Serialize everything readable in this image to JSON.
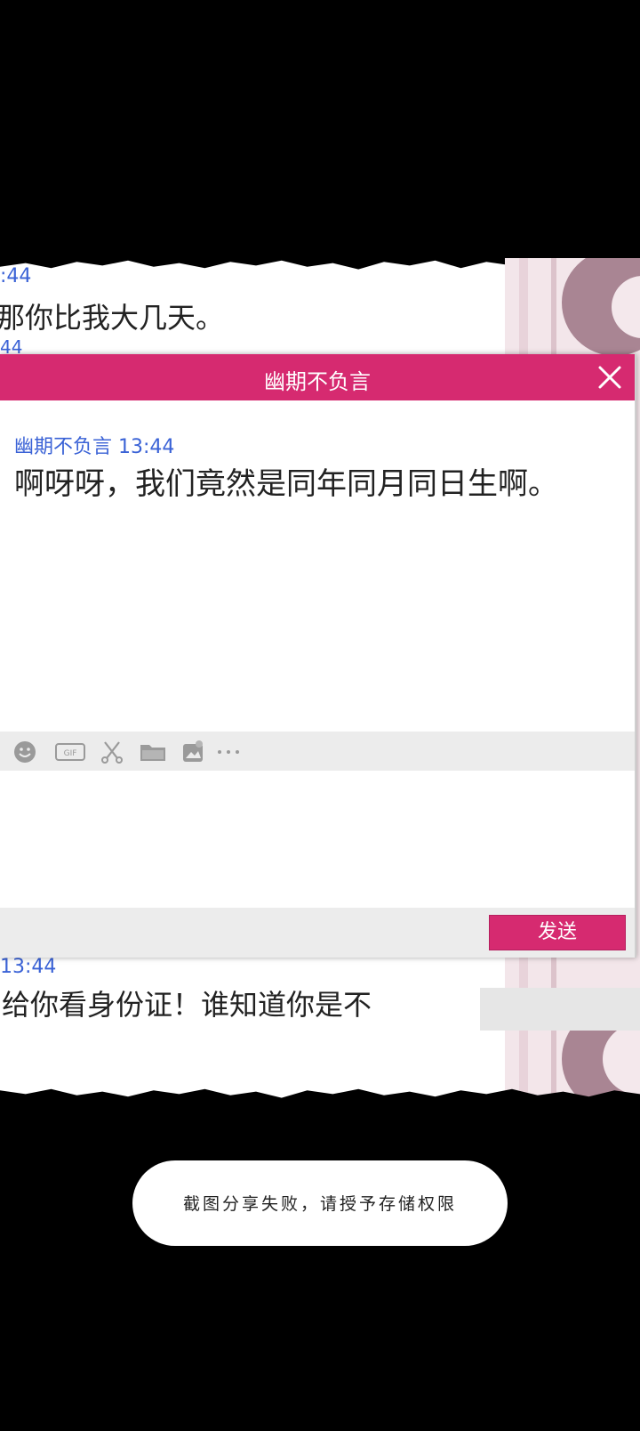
{
  "background_chat": {
    "time_top": ":44",
    "msg_top": "那你比我大几天。",
    "time_top2": "44",
    "time_bottom": "13:44",
    "msg_bottom": "给你看身份证！谁知道你是不"
  },
  "dialog": {
    "title": "幽期不负言",
    "message": {
      "sender": "幽期不负言",
      "time": "13:44",
      "text": "啊呀呀，我们竟然是同年同月同日生啊。"
    },
    "toolbar_icons": [
      "emoji-icon",
      "gif-icon",
      "scissors-icon",
      "folder-icon",
      "image-icon",
      "more-icon"
    ],
    "send_label": "发送"
  },
  "toast": {
    "text": "截图分享失败，请授予存储权限"
  },
  "colors": {
    "accent": "#d62a70",
    "link_blue": "#3a62d6"
  }
}
